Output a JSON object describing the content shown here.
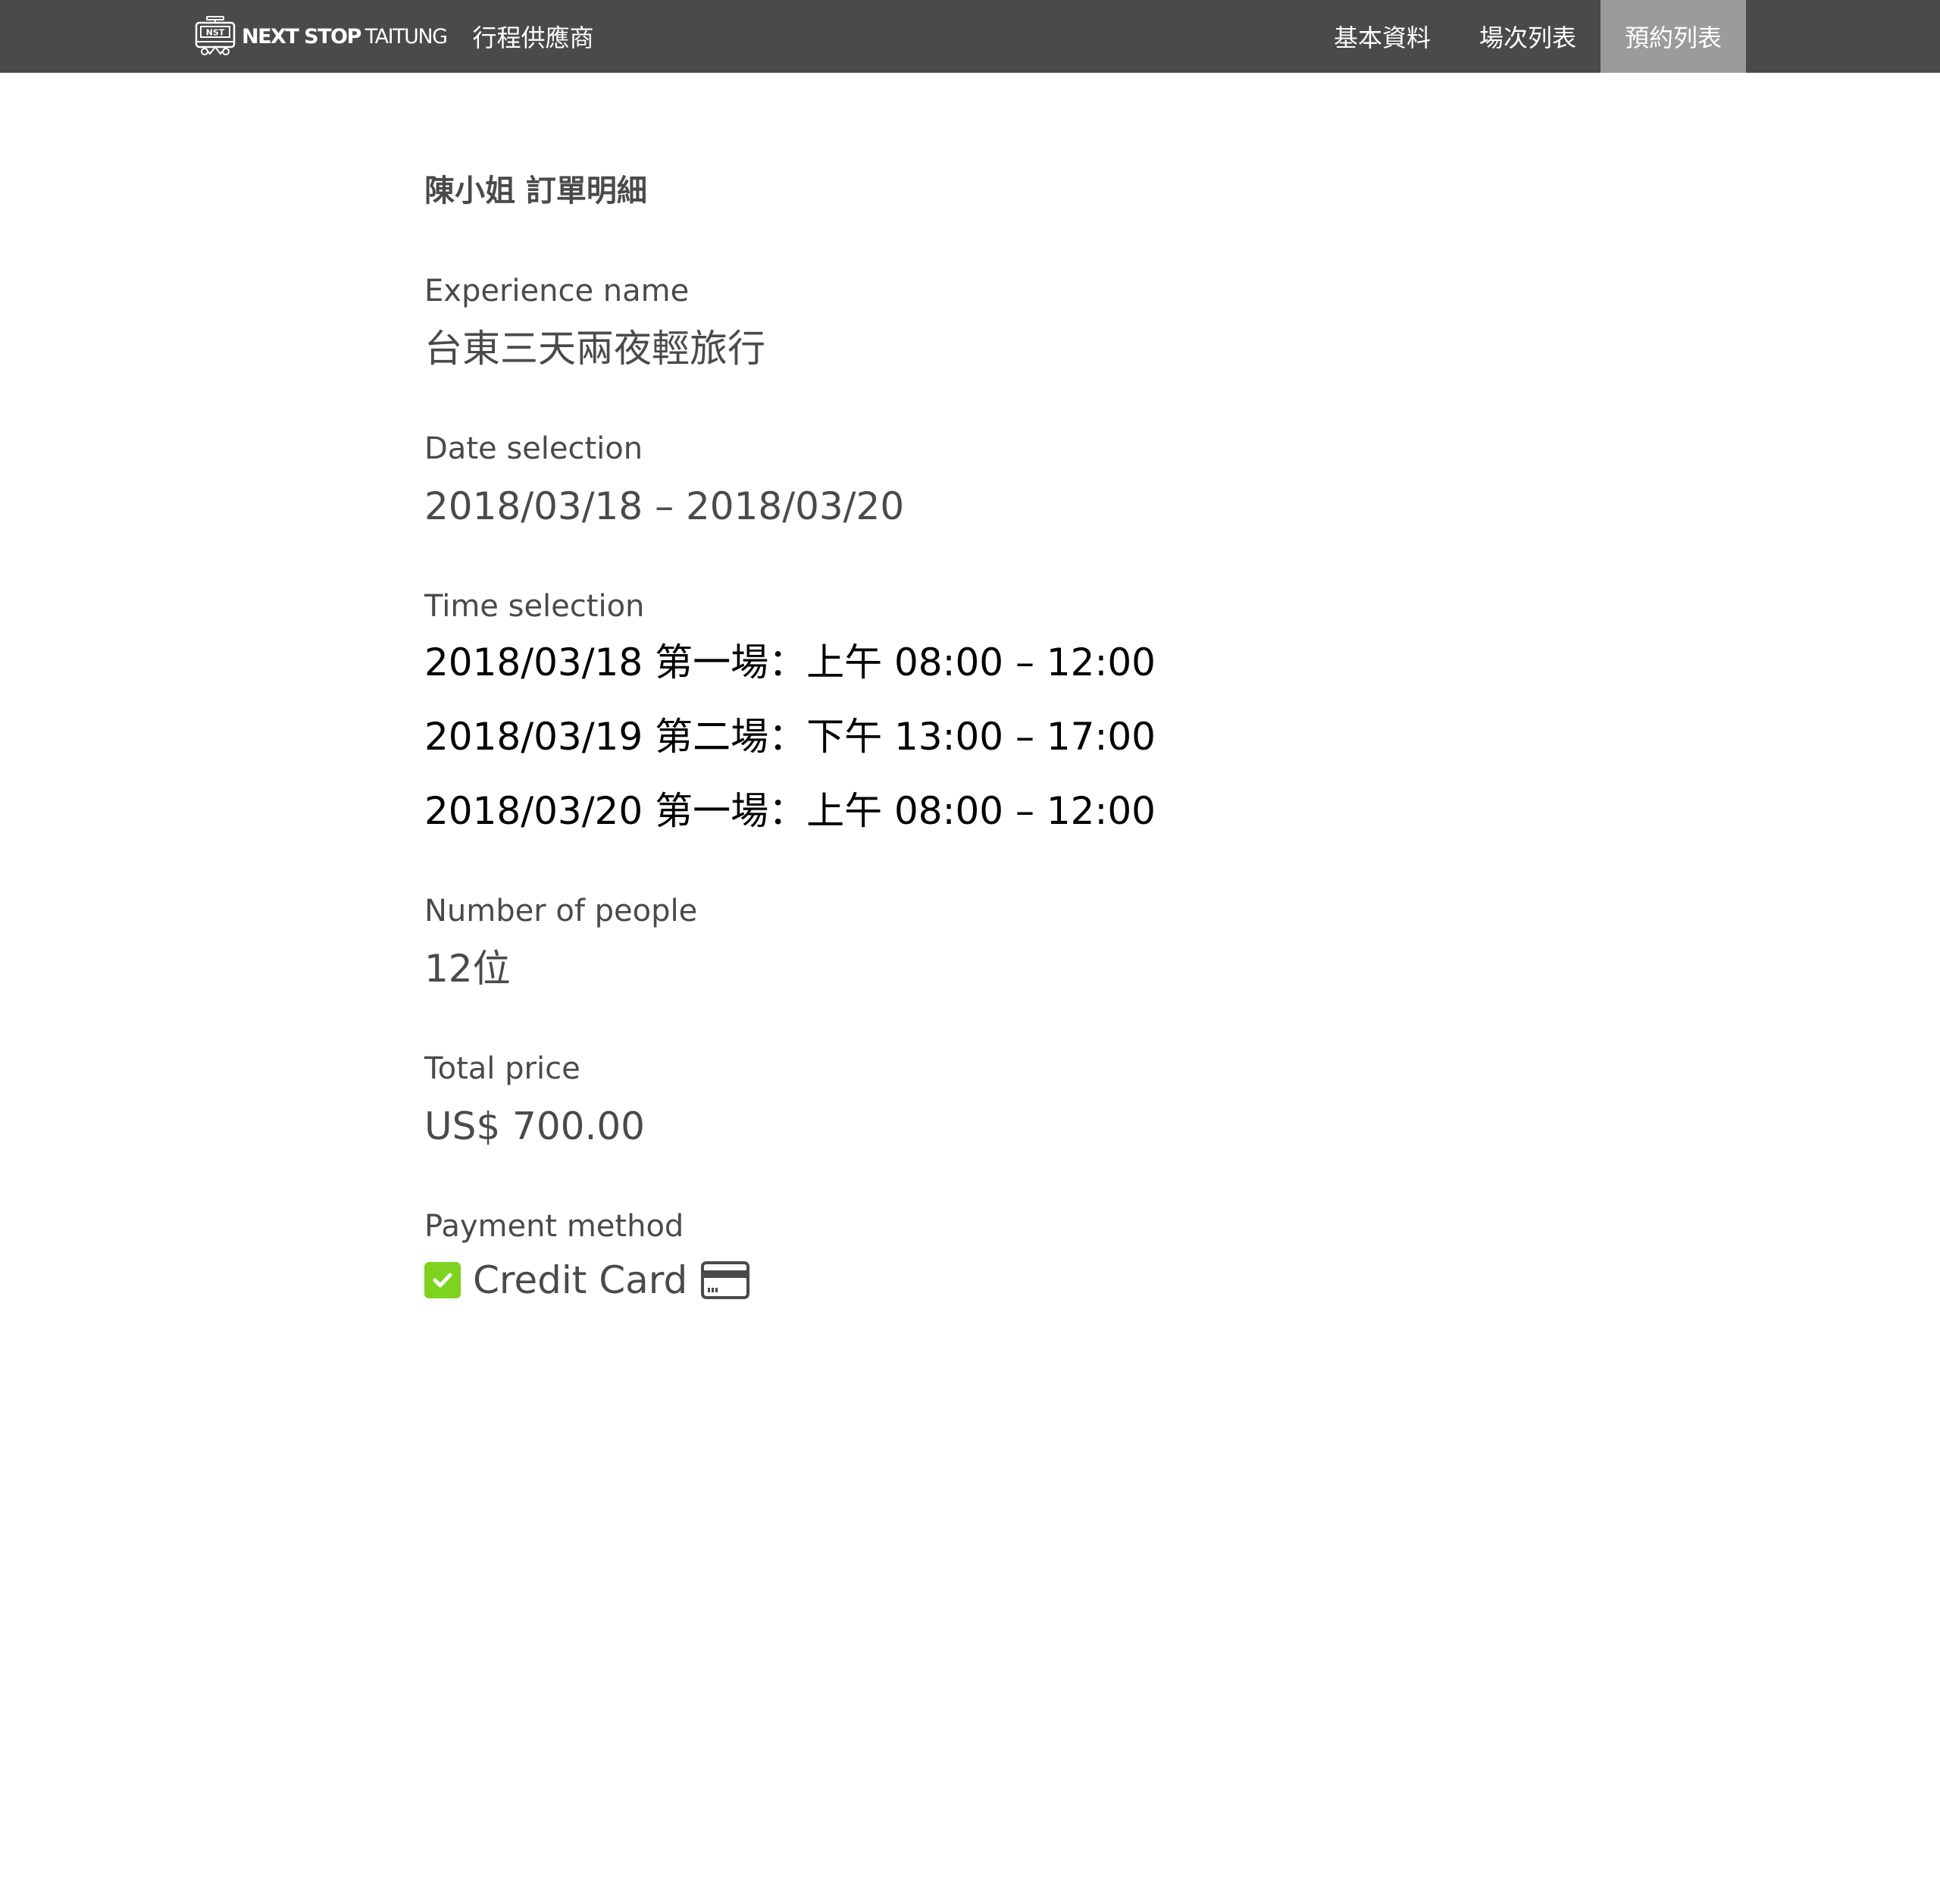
{
  "header": {
    "logo_text_bold": "NEXT STOP",
    "logo_text_thin": "TAITUNG",
    "logo_badge": "NST",
    "portal_title": "行程供應商",
    "nav": [
      {
        "label": "基本資料",
        "active": false
      },
      {
        "label": "場次列表",
        "active": false
      },
      {
        "label": "預約列表",
        "active": true
      }
    ]
  },
  "order": {
    "title": "陳小姐 訂單明細",
    "experience_label": "Experience name",
    "experience_value": "台東三天兩夜輕旅行",
    "date_label": "Date selection",
    "date_value": "2018/03/18 – 2018/03/20",
    "time_label": "Time selection",
    "time_slots": [
      "2018/03/18 第一場：上午 08:00 – 12:00",
      "2018/03/19 第二場：下午 13:00 – 17:00",
      "2018/03/20 第一場：上午 08:00 – 12:00"
    ],
    "people_label": "Number of people",
    "people_value": "12位",
    "price_label": "Total price",
    "price_value": "US$ 700.00",
    "payment_label": "Payment method",
    "payment_value": "Credit Card",
    "payment_checked": true,
    "payment_icon": "credit-card-icon",
    "check_icon": "checkbox-checked-icon"
  },
  "colors": {
    "navbar_bg": "#4a4a4a",
    "nav_active_bg": "#9b9b9b",
    "text": "#4a4a4a",
    "check_green": "#7ed321"
  }
}
